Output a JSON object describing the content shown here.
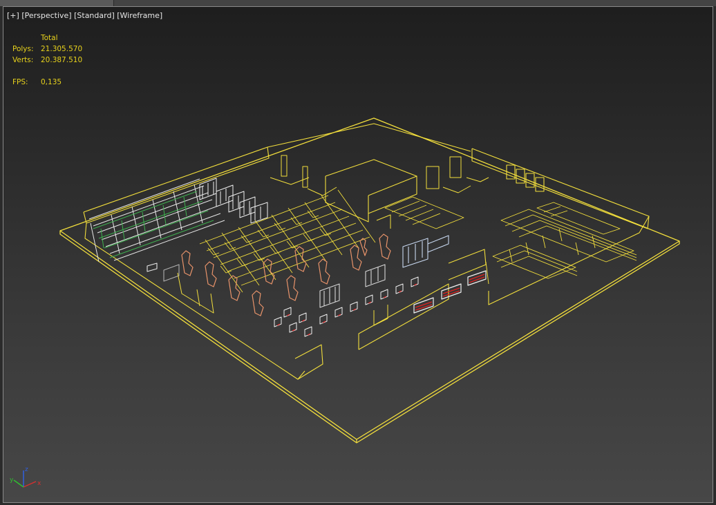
{
  "viewport": {
    "label_plus": "[+]",
    "label_view": "[Perspective]",
    "label_shading": "[Standard]",
    "label_mode": "[Wireframe]"
  },
  "stats": {
    "header": "Total",
    "polys_label": "Polys:",
    "polys_value": "21.305.570",
    "verts_label": "Verts:",
    "verts_value": "20.387.510",
    "fps_label": "FPS:",
    "fps_value": "0,135"
  },
  "gizmo": {
    "x_label": "x",
    "y_label": "y",
    "z_label": "z",
    "x_color": "#d63030",
    "y_color": "#30c030",
    "z_color": "#3060e0"
  },
  "colors": {
    "wire_yellow": "#f2de3c",
    "wire_white": "#f0f0f0",
    "wire_green": "#3fb050",
    "wire_orange": "#e8936a",
    "wire_red": "#e02020",
    "stats_text": "#e8d21c"
  }
}
